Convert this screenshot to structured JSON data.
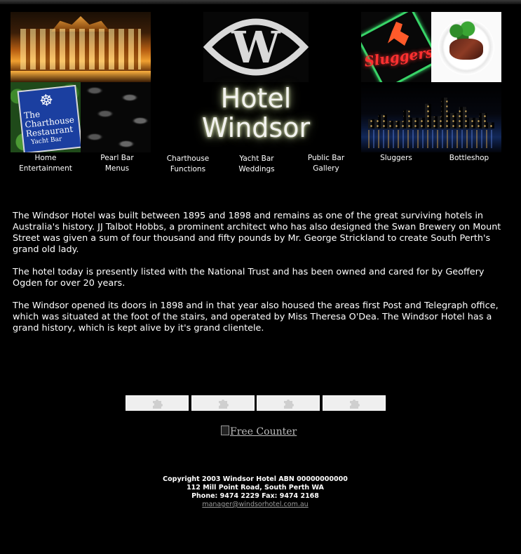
{
  "header": {
    "hotel_word_1": "Hotel",
    "hotel_word_2": "Windsor",
    "logo_letter": "W"
  },
  "images": {
    "charthouse_sign_line1": "The",
    "charthouse_sign_line2": "Charthouse",
    "charthouse_sign_line3": "Restaurant",
    "charthouse_sign_line4": "Yacht Bar",
    "sluggers_sign": "Sluggers"
  },
  "nav": [
    {
      "line1": "Home",
      "line2": "Entertainment"
    },
    {
      "line1": "Pearl Bar",
      "line2": "Menus"
    },
    {
      "line1": "Charthouse",
      "line2": "Functions"
    },
    {
      "line1": "Yacht Bar",
      "line2": "Weddings"
    },
    {
      "line1": "Public Bar",
      "line2": "Gallery"
    },
    {
      "line1": "Sluggers",
      "line2": ""
    },
    {
      "line1": "Bottleshop",
      "line2": ""
    }
  ],
  "content": {
    "p1": "The Windsor Hotel was built between 1895 and 1898 and remains as one of the great surviving hotels in Australia's history. JJ Talbot Hobbs, a prominent architect who has also designed the Swan Brewery on Mount Street was given a sum of four thousand and fifty pounds by Mr. George Strickland to create South Perth's grand old lady.",
    "p2": "The hotel today is presently listed with the National Trust and has been owned and cared for by Geoffery Ogden for over 20 years.",
    "p3": "The Windsor opened its doors in 1898 and in that year also housed the areas first Post and Telegraph office, which was situated at the foot of the stairs, and operated by Miss Theresa O'Dea. The Windsor Hotel has a grand history, which is kept alive by it's grand clientele."
  },
  "plugins": {
    "icon": "puzzle-piece-icon",
    "count": 4
  },
  "counter": {
    "alt_text": "Free Counter"
  },
  "footer": {
    "copyright": "Copyright 2003 Windsor Hotel ABN 00000000000",
    "address": "112 Mill Point Road, South Perth WA",
    "phone": "Phone: 9474 2229 Fax: 9474 2168",
    "email": "manager@windsorhotel.com.au"
  },
  "colors": {
    "background": "#000000",
    "text": "#ffffff",
    "footer_link": "#9a9a9a",
    "plugin_placeholder": "#efefef"
  }
}
